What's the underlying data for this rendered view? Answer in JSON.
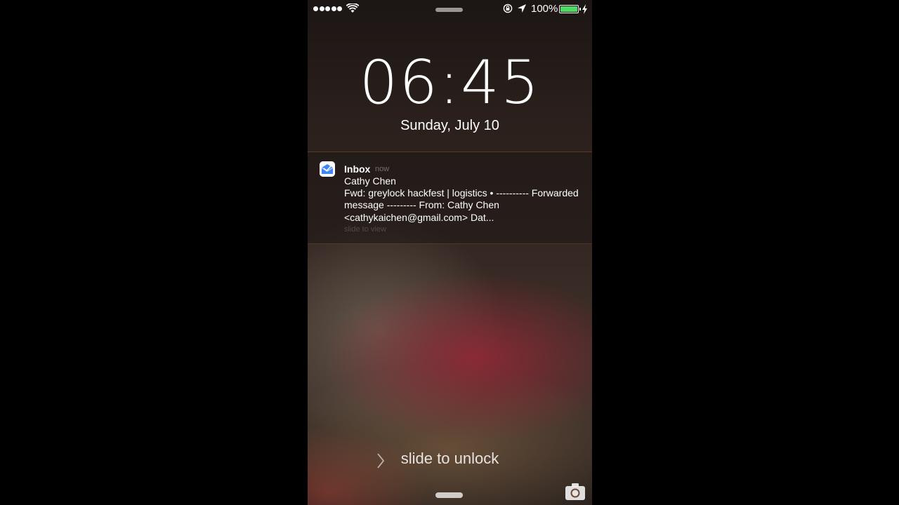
{
  "status_bar": {
    "signal_bars": 5,
    "battery_percent": "100%",
    "battery_level": 1.0,
    "battery_color": "#4cd964",
    "icons": [
      "signal-dots-icon",
      "wifi-icon",
      "rotation-lock-icon",
      "location-arrow-icon",
      "battery-icon",
      "charging-bolt-icon"
    ]
  },
  "lock_screen": {
    "time": "06:45",
    "date": "Sunday, July 10"
  },
  "notification": {
    "app_name": "Inbox",
    "timestamp": "now",
    "sender": "Cathy Chen",
    "body": "Fwd: greylock hackfest | logistics  •  ---------- Forwarded message --------- From: Cathy Chen <cathykaichen@gmail.com> Dat...",
    "action_hint": "slide to view",
    "icon": "inbox-app-icon"
  },
  "unlock": {
    "label": "slide to unlock",
    "icon": "chevron-right-icon"
  },
  "camera": {
    "icon": "camera-icon"
  }
}
